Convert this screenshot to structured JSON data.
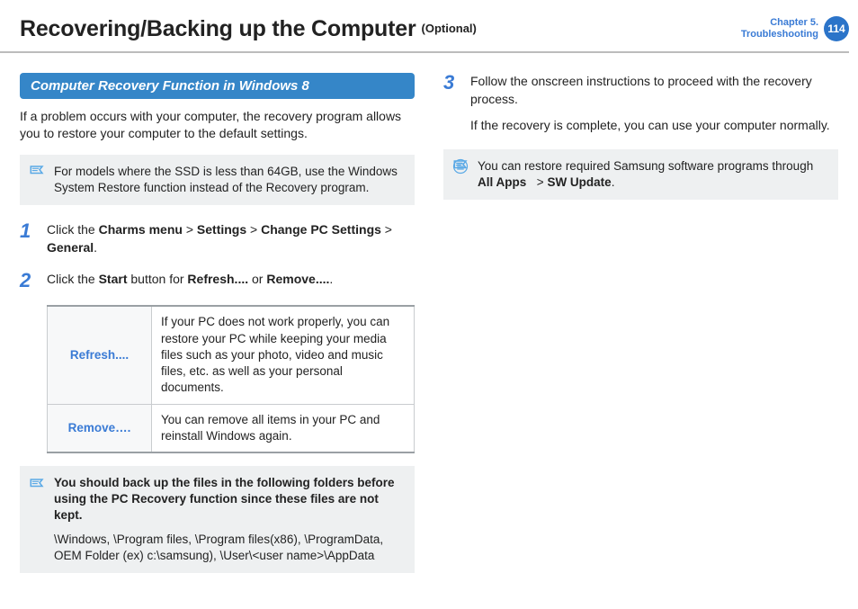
{
  "header": {
    "title": "Recovering/Backing up the Computer",
    "optional": "(Optional)",
    "chapter_line1": "Chapter 5.",
    "chapter_line2": "Troubleshooting",
    "page": "114"
  },
  "left": {
    "section_title": "Computer Recovery Function in Windows 8",
    "intro": "If a problem occurs with your computer, the recovery program allows you to restore your computer to the default settings.",
    "note1": "For models where the SSD is less than 64GB, use the Windows System Restore function instead of the Recovery program.",
    "step1": {
      "num": "1",
      "pre": "Click the ",
      "b1": "Charms menu",
      "gt1": " > ",
      "b2": "Settings",
      "gt2": " > ",
      "b3": "Change PC Settings",
      "gt3": " > ",
      "b4": "General",
      "post": "."
    },
    "step2": {
      "num": "2",
      "pre": "Click the ",
      "b1": "Start",
      "mid1": " button for ",
      "b2": "Refresh....",
      "mid2": " or ",
      "b3": "Remove....",
      "post": "."
    },
    "table": {
      "r1k": "Refresh....",
      "r1v": "If your PC does not work properly, you can restore your PC while keeping your media files such as your photo, video and music files, etc. as well as your personal documents.",
      "r2k": "Remove….",
      "r2v": "You can remove all items in your PC and reinstall Windows again."
    },
    "note2": {
      "bold": "You should back up the files in the following folders before using the PC Recovery function since these files are not kept.",
      "paths": "\\Windows, \\Program files, \\Program files(x86), \\ProgramData, OEM Folder (ex) c:\\samsung), \\User\\<user name>\\AppData"
    }
  },
  "right": {
    "step3": {
      "num": "3",
      "l1": "Follow the onscreen instructions to proceed with the recovery process.",
      "l2": "If the recovery is complete, you can use your computer normally."
    },
    "note": {
      "pre": "You can restore required Samsung software programs through ",
      "b1": "All Apps",
      "gt": " > ",
      "b2": "SW Update",
      "post": "."
    }
  },
  "icons": {
    "note": "note-icon",
    "list": "list-circle-icon"
  }
}
